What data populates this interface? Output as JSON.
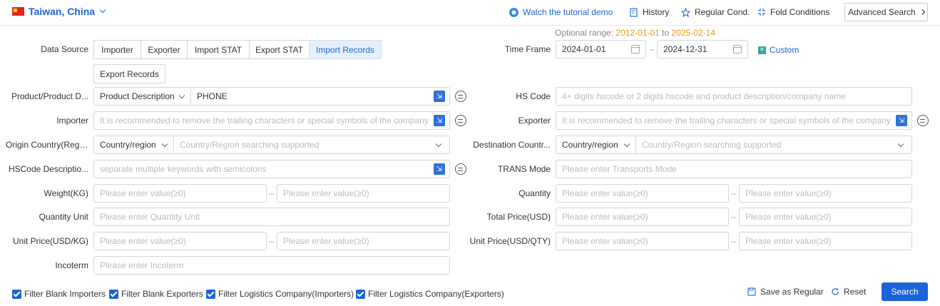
{
  "header": {
    "country": "Taiwan, China",
    "tutorial": "Watch the tutorial demo",
    "history": "History",
    "regular_cond": "Regular Cond.",
    "fold_conditions": "Fold Conditions",
    "advanced_search": "Advanced Search"
  },
  "optional_range": {
    "label": "Optional range:",
    "start": "2012-01-01",
    "to": "to",
    "end": "2025-02-14"
  },
  "data_source": {
    "label": "Data Source",
    "options": [
      "Importer",
      "Exporter",
      "Import STAT",
      "Export STAT",
      "Import Records",
      "Export Records"
    ],
    "selected": "Import Records"
  },
  "time_frame": {
    "label": "Time Frame",
    "start": "2024-01-01",
    "sep": "–",
    "end": "2024-12-31",
    "custom": "Custom"
  },
  "fields": {
    "product": {
      "label": "Product/Product D...",
      "select": "Product Description",
      "value": "PHONE"
    },
    "hs_code": {
      "label": "HS Code",
      "placeholder": "4+ digits hscode or 2 digits hscode and product description/company name"
    },
    "importer": {
      "label": "Importer",
      "placeholder": "It is recommended to remove the trailing characters or special symbols of the company"
    },
    "exporter": {
      "label": "Exporter",
      "placeholder": "It is recommended to remove the trailing characters or special symbols of the company"
    },
    "origin": {
      "label": "Origin Country(Regi...",
      "select": "Country/region",
      "placeholder": "Country/Region searching supported"
    },
    "destination": {
      "label": "Destination Countr...",
      "select": "Country/region",
      "placeholder": "Country/Region searching supported"
    },
    "hscode_desc": {
      "label": "HSCode Descriptio...",
      "placeholder": "separate multiple keywords with semicolons"
    },
    "trans_mode": {
      "label": "TRANS Mode",
      "placeholder": "Please enter Transports Mode"
    },
    "weight": {
      "label": "Weight(KG)",
      "placeholder": "Please enter value(≥0)"
    },
    "quantity": {
      "label": "Quantity",
      "placeholder": "Please enter value(≥0)"
    },
    "quantity_unit": {
      "label": "Quantity Unit",
      "placeholder": "Please enter Quantity Unit"
    },
    "total_price": {
      "label": "Total Price(USD)",
      "placeholder": "Please enter value(≥0)"
    },
    "unit_price_kg": {
      "label": "Unit Price(USD/KG)",
      "placeholder": "Please enter value(≥0)"
    },
    "unit_price_qty": {
      "label": "Unit Price(USD/QTY)",
      "placeholder": "Please enter value(≥0)"
    },
    "incoterm": {
      "label": "Incoterm",
      "placeholder": "Please enter Incoterm"
    }
  },
  "range_sep": "–",
  "filters": [
    {
      "label": "Filter Blank Importers",
      "checked": true
    },
    {
      "label": "Filter Blank Exporters",
      "checked": true
    },
    {
      "label": "Filter Logistics Company(Importers)",
      "checked": true
    },
    {
      "label": "Filter Logistics Company(Exporters)",
      "checked": true
    }
  ],
  "actions": {
    "save": "Save as Regular",
    "reset": "Reset",
    "search": "Search"
  },
  "colors": {
    "accent": "#1b64d8",
    "date_highlight": "#f39800"
  }
}
